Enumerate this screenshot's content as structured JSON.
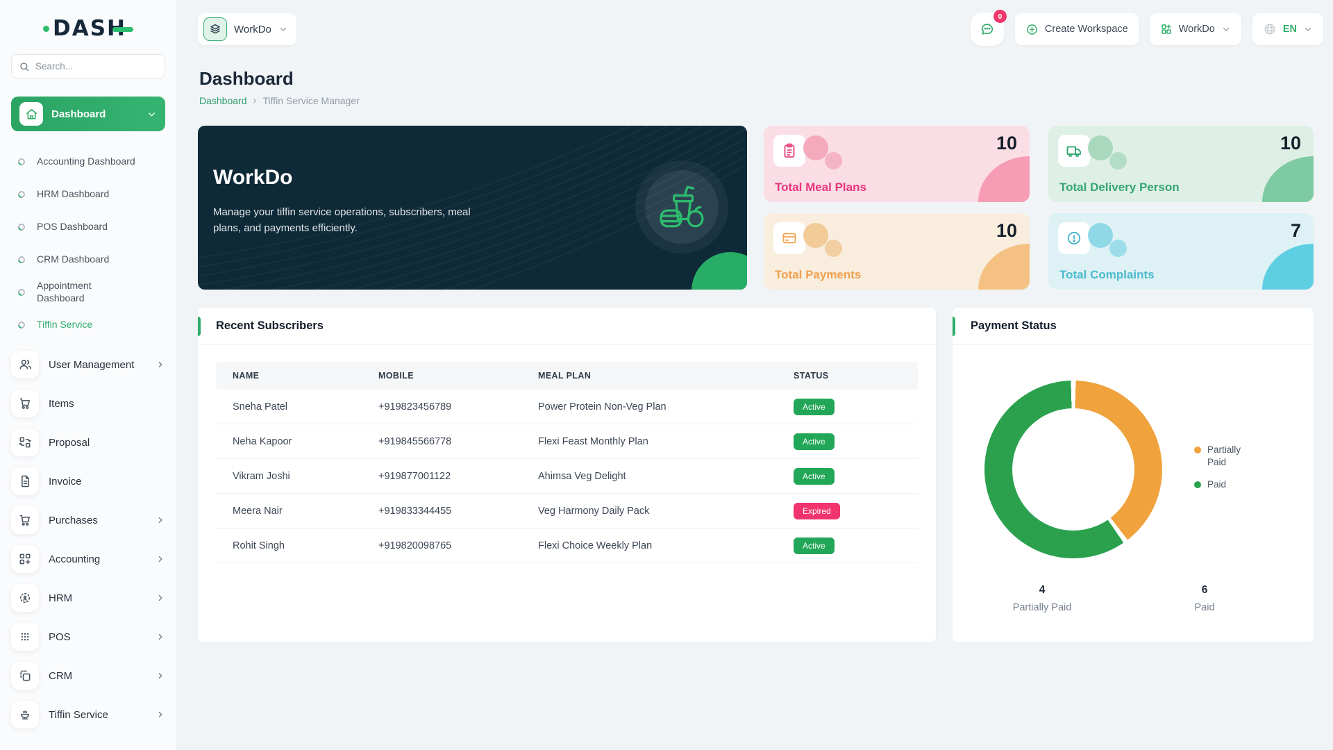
{
  "app": {
    "logo_text": "DASH"
  },
  "sidebar": {
    "search_placeholder": "Search...",
    "dashboard_label": "Dashboard",
    "submenu": [
      {
        "label": "Accounting Dashboard"
      },
      {
        "label": "HRM Dashboard"
      },
      {
        "label": "POS Dashboard"
      },
      {
        "label": "CRM Dashboard"
      },
      {
        "label": "Appointment Dashboard"
      },
      {
        "label": "Tiffin Service"
      }
    ],
    "menu": [
      {
        "label": "User Management"
      },
      {
        "label": "Items"
      },
      {
        "label": "Proposal"
      },
      {
        "label": "Invoice"
      },
      {
        "label": "Purchases"
      },
      {
        "label": "Accounting"
      },
      {
        "label": "HRM"
      },
      {
        "label": "POS"
      },
      {
        "label": "CRM"
      },
      {
        "label": "Tiffin Service"
      }
    ]
  },
  "topbar": {
    "workspace_label": "WorkDo",
    "chat_badge": "0",
    "create_workspace_label": "Create Workspace",
    "workdo_menu_label": "WorkDo",
    "language_label": "EN"
  },
  "page": {
    "title": "Dashboard",
    "breadcrumb_link": "Dashboard",
    "breadcrumb_current": "Tiffin Service Manager"
  },
  "hero": {
    "title": "WorkDo",
    "subtitle": "Manage your tiffin service operations, subscribers, meal plans, and payments efficiently."
  },
  "stats": [
    {
      "label": "Total Meal Plans",
      "value": "10"
    },
    {
      "label": "Total Delivery Person",
      "value": "10"
    },
    {
      "label": "Total Payments",
      "value": "10"
    },
    {
      "label": "Total Complaints",
      "value": "7"
    }
  ],
  "subscribers": {
    "title": "Recent Subscribers",
    "columns": [
      "NAME",
      "MOBILE",
      "MEAL PLAN",
      "STATUS"
    ],
    "rows": [
      {
        "name": "Sneha Patel",
        "mobile": "+919823456789",
        "plan": "Power Protein Non-Veg Plan",
        "status": "Active"
      },
      {
        "name": "Neha Kapoor",
        "mobile": "+919845566778",
        "plan": "Flexi Feast Monthly Plan",
        "status": "Active"
      },
      {
        "name": "Vikram Joshi",
        "mobile": "+919877001122",
        "plan": "Ahimsa Veg Delight",
        "status": "Active"
      },
      {
        "name": "Meera Nair",
        "mobile": "+919833344455",
        "plan": "Veg Harmony Daily Pack",
        "status": "Expired"
      },
      {
        "name": "Rohit Singh",
        "mobile": "+919820098765",
        "plan": "Flexi Choice Weekly Plan",
        "status": "Active"
      }
    ]
  },
  "payment_status": {
    "title": "Payment Status",
    "chart_data": {
      "type": "pie",
      "labels": [
        "Partially Paid",
        "Paid"
      ],
      "values": [
        4,
        6
      ],
      "colors": [
        "#F0A23C",
        "#2BA14E"
      ],
      "legend_position": "right"
    },
    "summary": [
      {
        "value": "4",
        "label": "Partially Paid"
      },
      {
        "value": "6",
        "label": "Paid"
      }
    ]
  },
  "colors": {
    "accent_green": "#2FAE68",
    "banner_navy": "#0E2A38",
    "status_active": "#21A757",
    "status_expired": "#F1346D",
    "badge_red": "#F0376B"
  }
}
